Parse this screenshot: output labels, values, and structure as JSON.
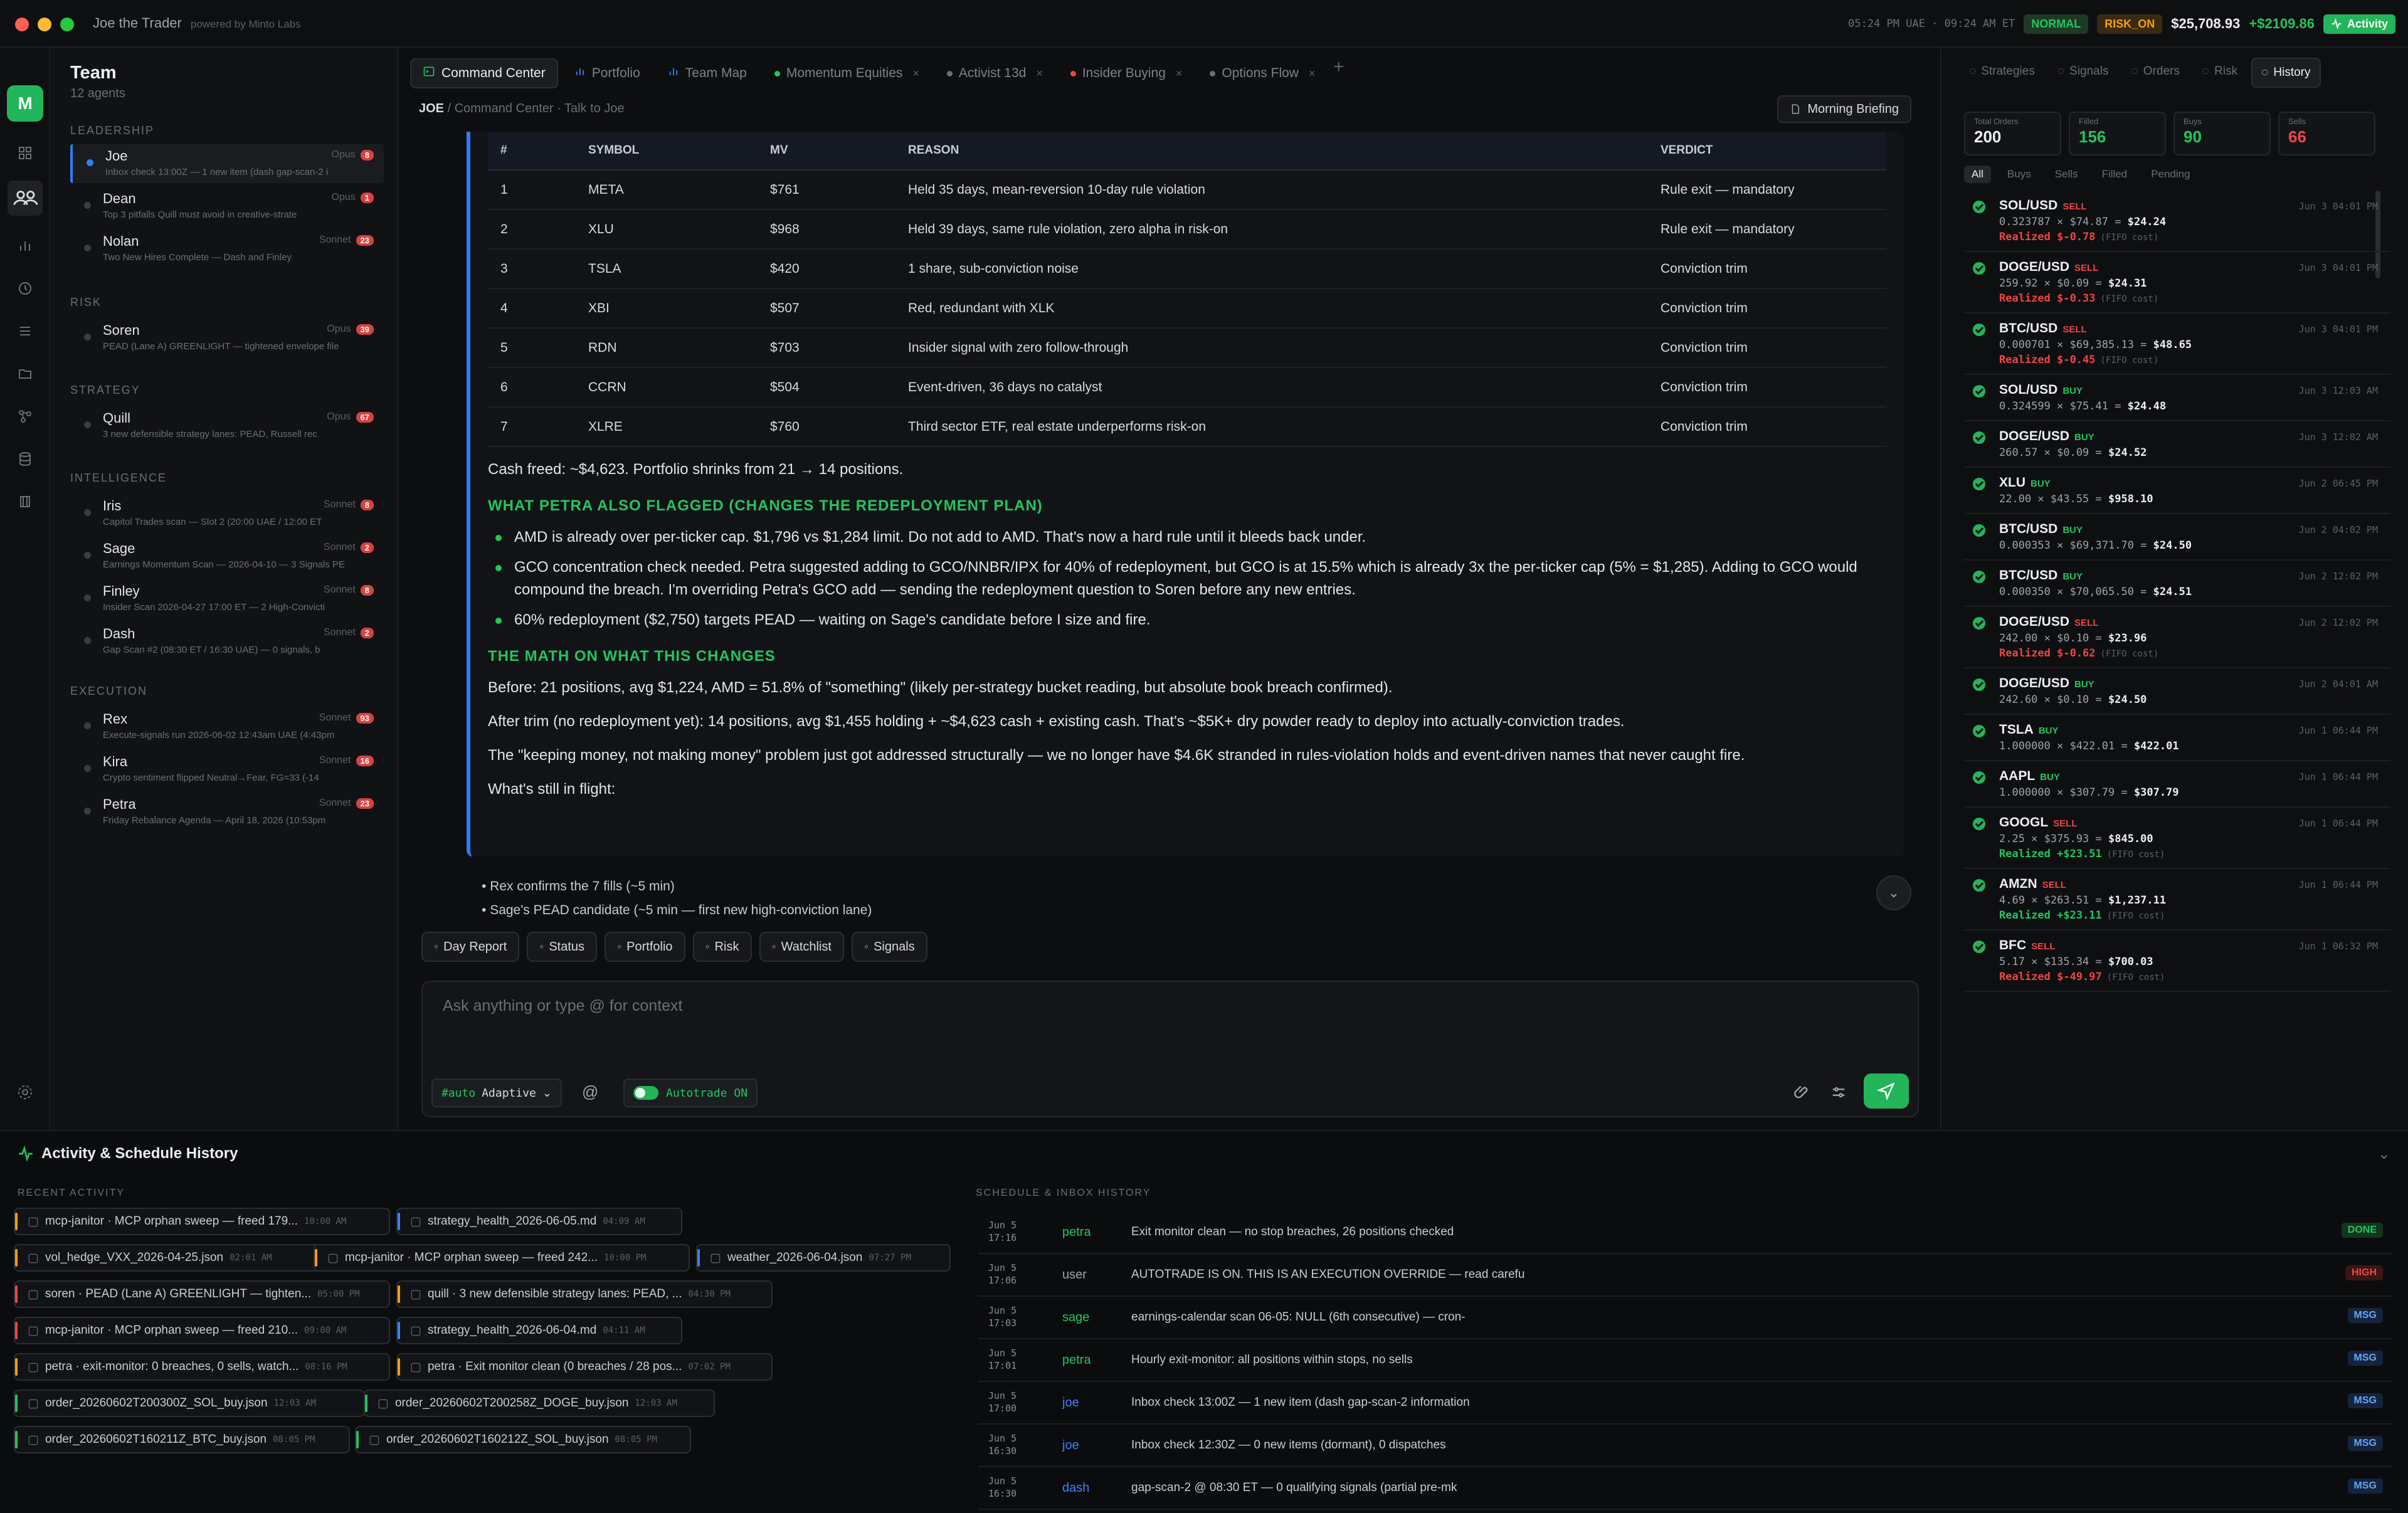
{
  "app": {
    "title": "Joe the Trader",
    "powered": "powered by Minto Labs"
  },
  "topbar": {
    "clock": "05:24 PM UAE · 09:24 AM ET",
    "mode_badge": "NORMAL",
    "regime_badge": "RISK_ON",
    "equity": "$25,708.93",
    "pnl": "+$2109.86",
    "activity_label": "Activity"
  },
  "team": {
    "title": "Team",
    "count": "12 agents",
    "sections": {
      "leadership": "LEADERSHIP",
      "risk": "RISK",
      "strategy": "STRATEGY",
      "intelligence": "INTELLIGENCE",
      "execution": "EXECUTION"
    },
    "agents": [
      {
        "name": "Joe",
        "model": "Opus",
        "count": "8",
        "status": "Inbox check 13:00Z — 1 new item (dash gap-scan-2 i"
      },
      {
        "name": "Dean",
        "model": "Opus",
        "count": "1",
        "status": "Top 3 pitfalls Quill must avoid in creative-strate"
      },
      {
        "name": "Nolan",
        "model": "Sonnet",
        "count": "23",
        "status": "Two New Hires Complete — Dash and Finley"
      },
      {
        "name": "Soren",
        "model": "Opus",
        "count": "39",
        "status": "PEAD (Lane A) GREENLIGHT — tightened envelope file"
      },
      {
        "name": "Quill",
        "model": "Opus",
        "count": "67",
        "status": "3 new defensible strategy lanes: PEAD, Russell rec"
      },
      {
        "name": "Iris",
        "model": "Sonnet",
        "count": "8",
        "status": "Capitol Trades scan — Slot 2 (20:00 UAE / 12:00 ET"
      },
      {
        "name": "Sage",
        "model": "Sonnet",
        "count": "2",
        "status": "Earnings Momentum Scan — 2026-04-10 — 3 Signals PE"
      },
      {
        "name": "Finley",
        "model": "Sonnet",
        "count": "8",
        "status": "Insider Scan 2026-04-27 17:00 ET — 2 High-Convicti"
      },
      {
        "name": "Dash",
        "model": "Sonnet",
        "count": "2",
        "status": "Gap Scan #2 (08:30 ET / 16:30 UAE) — 0 signals, b"
      },
      {
        "name": "Rex",
        "model": "Sonnet",
        "count": "93",
        "status": "Execute-signals run 2026-06-02 12:43am UAE (4:43pm"
      },
      {
        "name": "Kira",
        "model": "Sonnet",
        "count": "16",
        "status": "Crypto sentiment flipped Neutral→Fear, FG=33 (-14"
      },
      {
        "name": "Petra",
        "model": "Sonnet",
        "count": "23",
        "status": "Friday Rebalance Agenda — April 18, 2026 (10:53pm"
      }
    ]
  },
  "tabs": [
    {
      "label": "Command Center"
    },
    {
      "label": "Portfolio"
    },
    {
      "label": "Team Map"
    },
    {
      "label": "Momentum Equities"
    },
    {
      "label": "Activist 13d"
    },
    {
      "label": "Insider Buying"
    },
    {
      "label": "Options Flow"
    }
  ],
  "breadcrumb": {
    "root": "JOE",
    "rest": "/ Command Center · Talk to Joe"
  },
  "briefing_label": "Morning Briefing",
  "trim_table": {
    "headers": [
      "#",
      "SYMBOL",
      "MV",
      "REASON",
      "VERDICT"
    ],
    "rows": [
      [
        "1",
        "META",
        "$761",
        "Held 35 days, mean-reversion 10-day rule violation",
        "Rule exit — mandatory"
      ],
      [
        "2",
        "XLU",
        "$968",
        "Held 39 days, same rule violation, zero alpha in risk-on",
        "Rule exit — mandatory"
      ],
      [
        "3",
        "TSLA",
        "$420",
        "1 share, sub-conviction noise",
        "Conviction trim"
      ],
      [
        "4",
        "XBI",
        "$507",
        "Red, redundant with XLK",
        "Conviction trim"
      ],
      [
        "5",
        "RDN",
        "$703",
        "Insider signal with zero follow-through",
        "Conviction trim"
      ],
      [
        "6",
        "CCRN",
        "$504",
        "Event-driven, 36 days no catalyst",
        "Conviction trim"
      ],
      [
        "7",
        "XLRE",
        "$760",
        "Third sector ETF, real estate underperforms risk-on",
        "Conviction trim"
      ]
    ]
  },
  "message": {
    "cash_freed": "Cash freed: ~$4,623. Portfolio shrinks from 21 → 14 positions.",
    "petra_heading": "WHAT PETRA ALSO FLAGGED (CHANGES THE REDEPLOYMENT PLAN)",
    "petra_points": [
      "AMD is already over per-ticker cap. $1,796 vs $1,284 limit. Do not add to AMD. That's now a hard rule until it bleeds back under.",
      "GCO concentration check needed. Petra suggested adding to GCO/NNBR/IPX for 40% of redeployment, but GCO is at 15.5% which is already 3x the per-ticker cap (5% = $1,285). Adding to GCO would compound the breach. I'm overriding Petra's GCO add — sending the redeployment question to Soren before any new entries.",
      "60% redeployment ($2,750) targets PEAD — waiting on Sage's candidate before I size and fire."
    ],
    "math_heading": "THE MATH ON WHAT THIS CHANGES",
    "before": "Before: 21 positions, avg $1,224, AMD = 51.8% of \"something\" (likely per-strategy bucket reading, but absolute book breach confirmed).",
    "after": "After trim (no redeployment yet): 14 positions, avg $1,455 holding + ~$4,623 cash + existing cash. That's ~$5K+ dry powder ready to deploy into actually-conviction trades.",
    "keeping": "The \"keeping money, not making money\" problem just got addressed structurally — we no longer have $4.6K stranded in rules-violation holds and event-driven names that never caught fire.",
    "still": "What's still in flight:",
    "in_flight": [
      "Rex confirms the 7 fills (~5 min)",
      "Sage's PEAD candidate (~5 min — first new high-conviction lane)"
    ]
  },
  "quick_actions": [
    "Day Report",
    "Status",
    "Portfolio",
    "Risk",
    "Watchlist",
    "Signals"
  ],
  "composer": {
    "placeholder": "Ask anything or type @ for context",
    "mode_tag": "#auto",
    "mode_value": "Adaptive",
    "at": "@",
    "autotrade": "Autotrade ON"
  },
  "right": {
    "tabs": [
      "Strategies",
      "Signals",
      "Orders",
      "Risk",
      "History"
    ],
    "stats": [
      {
        "label": "Total Orders",
        "value": "200",
        "color": "#eceef2"
      },
      {
        "label": "Filled",
        "value": "156",
        "color": "#22c55e"
      },
      {
        "label": "Buys",
        "value": "90",
        "color": "#22c55e"
      },
      {
        "label": "Sells",
        "value": "66",
        "color": "#ef4444"
      }
    ],
    "filters": [
      "All",
      "Buys",
      "Sells",
      "Filled",
      "Pending"
    ],
    "history": [
      {
        "symbol": "SOL/USD",
        "side": "SELL",
        "time": "Jun 3 04:01 PM",
        "detail": "0.323787 × $74.87 = ",
        "total": "$24.24",
        "realized": "Realized $-0.78",
        "fifo": "(FIFO cost)",
        "gain": false
      },
      {
        "symbol": "DOGE/USD",
        "side": "SELL",
        "time": "Jun 3 04:01 PM",
        "detail": "259.92 × $0.09 = ",
        "total": "$24.31",
        "realized": "Realized $-0.33",
        "fifo": "(FIFO cost)",
        "gain": false
      },
      {
        "symbol": "BTC/USD",
        "side": "SELL",
        "time": "Jun 3 04:01 PM",
        "detail": "0.000701 × $69,385.13 = ",
        "total": "$48.65",
        "realized": "Realized $-0.45",
        "fifo": "(FIFO cost)",
        "gain": false
      },
      {
        "symbol": "SOL/USD",
        "side": "BUY",
        "time": "Jun 3 12:03 AM",
        "detail": "0.324599 × $75.41 = ",
        "total": "$24.48",
        "realized": "",
        "fifo": "",
        "gain": true
      },
      {
        "symbol": "DOGE/USD",
        "side": "BUY",
        "time": "Jun 3 12:02 AM",
        "detail": "260.57 × $0.09 = ",
        "total": "$24.52",
        "realized": "",
        "fifo": "",
        "gain": true
      },
      {
        "symbol": "XLU",
        "side": "BUY",
        "time": "Jun 2 06:45 PM",
        "detail": "22.00 × $43.55 = ",
        "total": "$958.10",
        "realized": "",
        "fifo": "",
        "gain": true
      },
      {
        "symbol": "BTC/USD",
        "side": "BUY",
        "time": "Jun 2 04:02 PM",
        "detail": "0.000353 × $69,371.70 = ",
        "total": "$24.50",
        "realized": "",
        "fifo": "",
        "gain": true
      },
      {
        "symbol": "BTC/USD",
        "side": "BUY",
        "time": "Jun 2 12:02 PM",
        "detail": "0.000350 × $70,065.50 = ",
        "total": "$24.51",
        "realized": "",
        "fifo": "",
        "gain": true
      },
      {
        "symbol": "DOGE/USD",
        "side": "SELL",
        "time": "Jun 2 12:02 PM",
        "detail": "242.00 × $0.10 = ",
        "total": "$23.96",
        "realized": "Realized $-0.62",
        "fifo": "(FIFO cost)",
        "gain": false
      },
      {
        "symbol": "DOGE/USD",
        "side": "BUY",
        "time": "Jun 2 04:01 AM",
        "detail": "242.60 × $0.10 = ",
        "total": "$24.50",
        "realized": "",
        "fifo": "",
        "gain": true
      },
      {
        "symbol": "TSLA",
        "side": "BUY",
        "time": "Jun 1 06:44 PM",
        "detail": "1.000000 × $422.01 = ",
        "total": "$422.01",
        "realized": "",
        "fifo": "",
        "gain": true
      },
      {
        "symbol": "AAPL",
        "side": "BUY",
        "time": "Jun 1 06:44 PM",
        "detail": "1.000000 × $307.79 = ",
        "total": "$307.79",
        "realized": "",
        "fifo": "",
        "gain": true
      },
      {
        "symbol": "GOOGL",
        "side": "SELL",
        "time": "Jun 1 06:44 PM",
        "detail": "2.25 × $375.93 = ",
        "total": "$845.00",
        "realized": "Realized +$23.51",
        "fifo": "(FIFO cost)",
        "gain": true
      },
      {
        "symbol": "AMZN",
        "side": "SELL",
        "time": "Jun 1 06:44 PM",
        "detail": "4.69 × $263.51 = ",
        "total": "$1,237.11",
        "realized": "Realized +$23.11",
        "fifo": "(FIFO cost)",
        "gain": true
      },
      {
        "symbol": "BFC",
        "side": "SELL",
        "time": "Jun 1 06:32 PM",
        "detail": "5.17 × $135.34 = ",
        "total": "$700.03",
        "realized": "Realized $-49.97",
        "fifo": "(FIFO cost)",
        "gain": false
      }
    ]
  },
  "bottom": {
    "title": "Activity & Schedule History",
    "recent_label": "RECENT ACTIVITY",
    "schedule_label": "SCHEDULE & INBOX HISTORY",
    "chips": [
      {
        "text": "mcp-janitor · MCP orphan sweep — freed 179...",
        "time": "10:00 AM",
        "color": "#f59e0b"
      },
      {
        "text": "strategy_health_2026-06-05.md",
        "time": "04:09 AM",
        "color": "#3b82f6"
      },
      {
        "text": "vol_hedge_VXX_2026-04-25.json",
        "time": "02:01 AM",
        "color": "#f59e0b"
      },
      {
        "text": "mcp-janitor · MCP orphan sweep — freed 242...",
        "time": "10:00 PM",
        "color": "#f59e0b"
      },
      {
        "text": "weather_2026-06-04.json",
        "time": "07:27 PM",
        "color": "#3b82f6"
      },
      {
        "text": "soren · PEAD (Lane A) GREENLIGHT — tighten...",
        "time": "05:00 PM",
        "color": "#ef4444"
      },
      {
        "text": "quill · 3 new defensible strategy lanes: PEAD, ...",
        "time": "04:30 PM",
        "color": "#f59e0b"
      },
      {
        "text": "mcp-janitor · MCP orphan sweep — freed 210...",
        "time": "09:00 AM",
        "color": "#ef4444"
      },
      {
        "text": "strategy_health_2026-06-04.md",
        "time": "04:11 AM",
        "color": "#3b82f6"
      },
      {
        "text": "petra · exit-monitor: 0 breaches, 0 sells, watch...",
        "time": "08:16 PM",
        "color": "#f59e0b"
      },
      {
        "text": "petra · Exit monitor clean (0 breaches / 28 pos...",
        "time": "07:02 PM",
        "color": "#f59e0b"
      },
      {
        "text": "order_20260602T200300Z_SOL_buy.json",
        "time": "12:03 AM",
        "color": "#22c55e"
      },
      {
        "text": "order_20260602T200258Z_DOGE_buy.json",
        "time": "12:03 AM",
        "color": "#22c55e"
      },
      {
        "text": "order_20260602T160211Z_BTC_buy.json",
        "time": "08:05 PM",
        "color": "#22c55e"
      },
      {
        "text": "order_20260602T160212Z_SOL_buy.json",
        "time": "08:05 PM",
        "color": "#22c55e"
      }
    ],
    "schedule": [
      {
        "date": "Jun 5",
        "time": "17:16",
        "agent": "petra",
        "text": "Exit monitor clean — no stop breaches, 26 positions checked",
        "badge": "DONE"
      },
      {
        "date": "Jun 5",
        "time": "17:06",
        "agent": "user",
        "text": "AUTOTRADE IS ON. THIS IS AN EXECUTION OVERRIDE — read carefu",
        "badge": "HIGH"
      },
      {
        "date": "Jun 5",
        "time": "17:03",
        "agent": "sage",
        "text": "earnings-calendar scan 06-05: NULL (6th consecutive) — cron-",
        "badge": "MSG"
      },
      {
        "date": "Jun 5",
        "time": "17:01",
        "agent": "petra",
        "text": "Hourly exit-monitor: all positions within stops, no sells",
        "badge": "MSG"
      },
      {
        "date": "Jun 5",
        "time": "17:00",
        "agent": "joe",
        "text": "Inbox check 13:00Z — 1 new item (dash gap-scan-2 information",
        "badge": "MSG"
      },
      {
        "date": "Jun 5",
        "time": "16:30",
        "agent": "joe",
        "text": "Inbox check 12:30Z — 0 new items (dormant), 0 dispatches",
        "badge": "MSG"
      },
      {
        "date": "Jun 5",
        "time": "16:30",
        "agent": "dash",
        "text": "gap-scan-2 @ 08:30 ET — 0 qualifying signals (partial pre-mk",
        "badge": "MSG"
      }
    ]
  },
  "colors": {
    "accent": "#22b559",
    "link": "#2f7df6",
    "sell": "#ef4444",
    "buy": "#22c55e",
    "warn": "#f59e0b"
  }
}
